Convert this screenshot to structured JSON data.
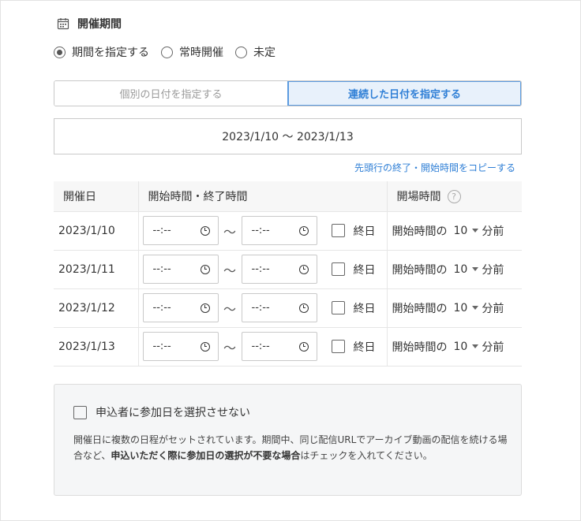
{
  "section": {
    "title": "開催期間",
    "icon": "calendar-icon"
  },
  "period_options": [
    {
      "label": "期間を指定する",
      "selected": true
    },
    {
      "label": "常時開催",
      "selected": false
    },
    {
      "label": "未定",
      "selected": false
    }
  ],
  "date_mode": {
    "individual_label": "個別の日付を指定する",
    "range_label": "連続した日付を指定する",
    "active": "range"
  },
  "date_range": "2023/1/10 〜 2023/1/13",
  "copy_link": "先頭行の終了・開始時間をコピーする",
  "table": {
    "headers": {
      "date": "開催日",
      "times": "開始時間・終了時間",
      "open": "開場時間"
    },
    "time_placeholder": "--:--",
    "separator": "〜",
    "allday_label": "終日",
    "open_prefix": "開始時間の",
    "open_suffix": "分前",
    "rows": [
      {
        "date": "2023/1/10",
        "open_minutes": "10"
      },
      {
        "date": "2023/1/11",
        "open_minutes": "10"
      },
      {
        "date": "2023/1/12",
        "open_minutes": "10"
      },
      {
        "date": "2023/1/13",
        "open_minutes": "10"
      }
    ]
  },
  "notice": {
    "checkbox_label": "申込者に参加日を選択させない",
    "text_before": "開催日に複数の日程がセットされています。期間中、同じ配信URLでアーカイブ動画の配信を続ける場合など、",
    "text_bold": "申込いただく際に参加日の選択が不要な場合",
    "text_after": "はチェックを入れてください。"
  },
  "colors": {
    "accent": "#2f7fd6",
    "accent_bg": "#e8f1fb",
    "header_bg": "#f7f7f7",
    "notice_bg": "#f5f6f7"
  }
}
